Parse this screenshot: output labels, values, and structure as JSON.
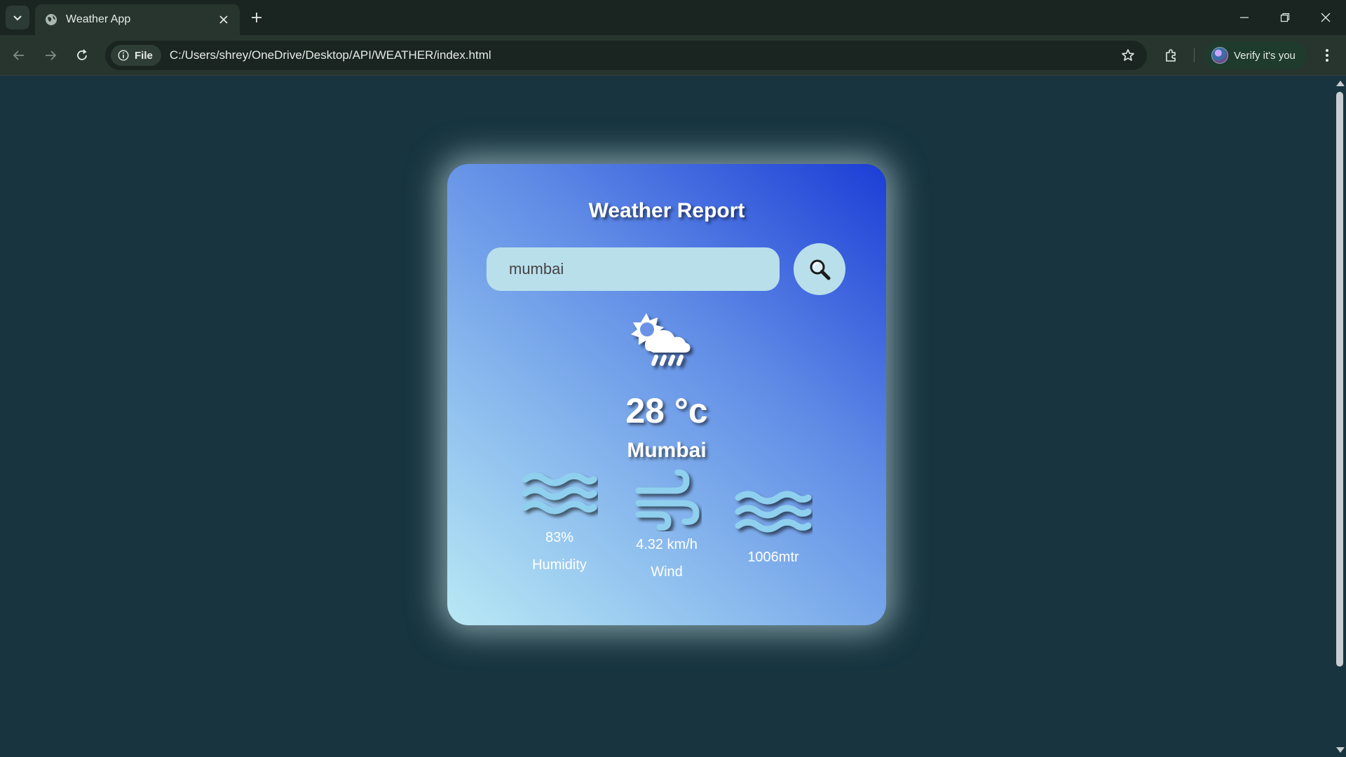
{
  "browser": {
    "tab_title": "Weather App",
    "site_chip_label": "File",
    "url": "C:/Users/shrey/OneDrive/Desktop/API/WEATHER/index.html",
    "verify_label": "Verify it's you"
  },
  "card": {
    "title": "Weather Report",
    "search_value": "mumbai",
    "temperature": "28 °c",
    "city": "Mumbai",
    "weather_icon": "sun-cloud-rain-icon"
  },
  "stats": {
    "humidity": {
      "value": "83%",
      "label": "Humidity",
      "icon": "waves-icon"
    },
    "wind": {
      "value": "4.32 km/h",
      "label": "Wind",
      "icon": "wind-icon"
    },
    "pressure": {
      "value": "1006mtr",
      "icon": "waves-icon"
    }
  },
  "colors": {
    "page_bg": "#17343f",
    "card_gradient_start": "#b9e9f4",
    "card_gradient_end": "#1c3dd6",
    "input_bg": "#b9dfeb",
    "stat_icon": "#8fd0ee"
  }
}
